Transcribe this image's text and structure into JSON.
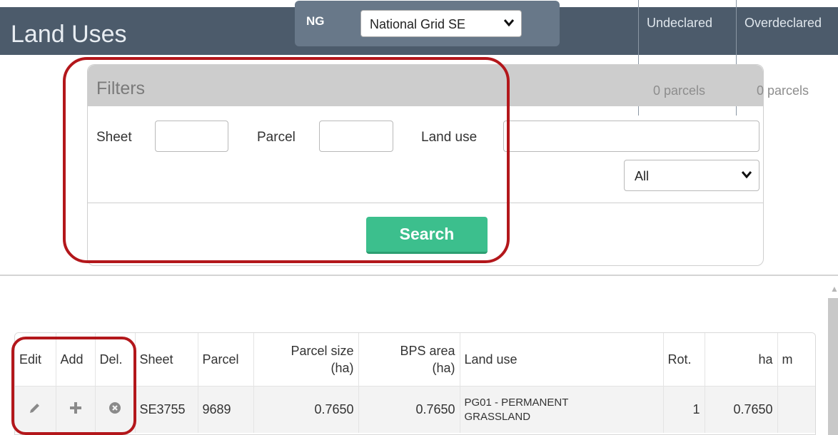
{
  "header": {
    "title": "Land Uses",
    "org_code": "NG",
    "org_select_value": "National Grid SE",
    "columns": [
      "Undeclared",
      "Overdeclared"
    ],
    "parcel_counts": [
      "0 parcels",
      "0 parcels"
    ]
  },
  "filters": {
    "title": "Filters",
    "sheet_label": "Sheet",
    "parcel_label": "Parcel",
    "land_use_label": "Land use",
    "sheet_value": "",
    "parcel_value": "",
    "land_use_value": "",
    "status_select_value": "All",
    "search_button": "Search"
  },
  "table": {
    "headers": {
      "edit": "Edit",
      "add": "Add",
      "del": "Del.",
      "sheet": "Sheet",
      "parcel": "Parcel",
      "parcel_size_1": "Parcel size",
      "parcel_size_2": "(ha)",
      "bps_area_1": "BPS area",
      "bps_area_2": "(ha)",
      "land_use": "Land use",
      "rot": "Rot.",
      "ha": "ha",
      "m": "m"
    },
    "rows": [
      {
        "edit_icon": "pencil-icon",
        "add_icon": "plus-icon",
        "delete_icon": "circle-x-icon",
        "sheet": "SE3755",
        "parcel": "9689",
        "parcel_size": "0.7650",
        "bps_area": "0.7650",
        "land_use_line1": "PG01 - PERMANENT",
        "land_use_line2": "GRASSLAND",
        "rot": "1",
        "ha": "0.7650",
        "m": ""
      }
    ]
  },
  "colors": {
    "header_bg": "#4c5b6b",
    "search_button": "#3cbf8d",
    "highlight": "#b3171b"
  }
}
